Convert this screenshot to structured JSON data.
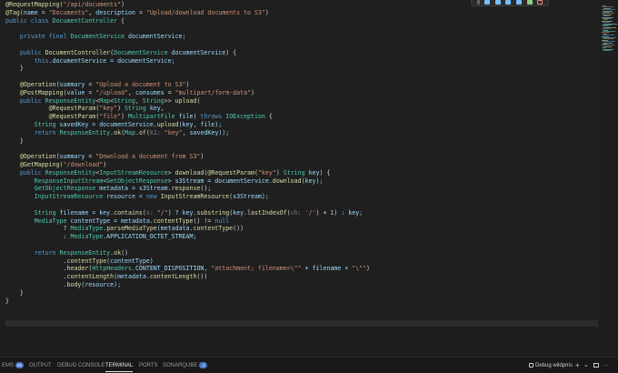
{
  "code_lines": [
    [
      [
        "@RequestMapping(",
        "ann"
      ],
      [
        "\"/api/documents\"",
        "str"
      ],
      [
        ")",
        "pl"
      ]
    ],
    [
      [
        "@Tag(",
        "ann"
      ],
      [
        "name",
        "var"
      ],
      [
        " = ",
        "pl"
      ],
      [
        "\"Documents\"",
        "str"
      ],
      [
        ", ",
        "pl"
      ],
      [
        "description",
        "var"
      ],
      [
        " = ",
        "pl"
      ],
      [
        "\"Upload/download documents to S3\"",
        "str"
      ],
      [
        ")",
        "pl"
      ]
    ],
    [
      [
        "public class ",
        "kw"
      ],
      [
        "DocumentController",
        "ty"
      ],
      [
        " {",
        "pl"
      ]
    ],
    [],
    [
      [
        "    private final ",
        "kw"
      ],
      [
        "DocumentService",
        "ty"
      ],
      [
        " documentService;",
        "var"
      ]
    ],
    [],
    [
      [
        "    public ",
        "kw"
      ],
      [
        "DocumentController",
        "fn"
      ],
      [
        "(",
        "pl"
      ],
      [
        "DocumentService",
        "ty"
      ],
      [
        " documentService",
        "var"
      ],
      [
        ") {",
        "pl"
      ]
    ],
    [
      [
        "        this",
        "kw"
      ],
      [
        ".documentService = documentService;",
        "var"
      ]
    ],
    [
      [
        "    }",
        "pl"
      ]
    ],
    [],
    [
      [
        "    @Operation(",
        "ann"
      ],
      [
        "summary",
        "var"
      ],
      [
        " = ",
        "pl"
      ],
      [
        "\"Upload a document to S3\"",
        "str"
      ],
      [
        ")",
        "pl"
      ]
    ],
    [
      [
        "    @PostMapping(",
        "ann"
      ],
      [
        "value",
        "var"
      ],
      [
        " = ",
        "pl"
      ],
      [
        "\"/upload\"",
        "str"
      ],
      [
        ", ",
        "pl"
      ],
      [
        "consumes",
        "var"
      ],
      [
        " = ",
        "pl"
      ],
      [
        "\"multipart/form-data\"",
        "str"
      ],
      [
        ")",
        "pl"
      ]
    ],
    [
      [
        "    public ",
        "kw"
      ],
      [
        "ResponseEntity",
        "ty"
      ],
      [
        "<",
        "pl"
      ],
      [
        "Map",
        "ty"
      ],
      [
        "<",
        "pl"
      ],
      [
        "String",
        "ty"
      ],
      [
        ", ",
        "pl"
      ],
      [
        "String",
        "ty"
      ],
      [
        ">> ",
        "pl"
      ],
      [
        "upload",
        "fn"
      ],
      [
        "(",
        "pl"
      ]
    ],
    [
      [
        "            @RequestParam(",
        "ann"
      ],
      [
        "\"key\"",
        "str"
      ],
      [
        ") ",
        "pl"
      ],
      [
        "String",
        "ty"
      ],
      [
        " key,",
        "var"
      ]
    ],
    [
      [
        "            @RequestParam(",
        "ann"
      ],
      [
        "\"file\"",
        "str"
      ],
      [
        ") ",
        "pl"
      ],
      [
        "MultipartFile",
        "ty"
      ],
      [
        " file",
        "var"
      ],
      [
        ") ",
        "pl"
      ],
      [
        "throws ",
        "kw"
      ],
      [
        "IOException",
        "ty"
      ],
      [
        " {",
        "pl"
      ]
    ],
    [
      [
        "        String",
        "ty"
      ],
      [
        " savedKey = documentService.",
        "var"
      ],
      [
        "upload",
        "fn"
      ],
      [
        "(key, file);",
        "var"
      ]
    ],
    [
      [
        "        return ",
        "kw"
      ],
      [
        "ResponseEntity",
        "ty"
      ],
      [
        ".",
        "pl"
      ],
      [
        "ok",
        "fn"
      ],
      [
        "(",
        "pl"
      ],
      [
        "Map",
        "ty"
      ],
      [
        ".",
        "pl"
      ],
      [
        "of",
        "fn"
      ],
      [
        "(",
        "pl"
      ],
      [
        "k1:",
        "hint"
      ],
      [
        " \"key\"",
        "str"
      ],
      [
        ", savedKey));",
        "var"
      ]
    ],
    [
      [
        "    }",
        "pl"
      ]
    ],
    [],
    [
      [
        "    @Operation(",
        "ann"
      ],
      [
        "summary",
        "var"
      ],
      [
        " = ",
        "pl"
      ],
      [
        "\"Download a document from S3\"",
        "str"
      ],
      [
        ")",
        "pl"
      ]
    ],
    [
      [
        "    @GetMapping(",
        "ann"
      ],
      [
        "\"/download\"",
        "str"
      ],
      [
        ")",
        "pl"
      ]
    ],
    [
      [
        "    public ",
        "kw"
      ],
      [
        "ResponseEntity",
        "ty"
      ],
      [
        "<",
        "pl"
      ],
      [
        "InputStreamResource",
        "ty"
      ],
      [
        "> ",
        "pl"
      ],
      [
        "download",
        "fn"
      ],
      [
        "(",
        "pl"
      ],
      [
        "@RequestParam(",
        "ann"
      ],
      [
        "\"key\"",
        "str"
      ],
      [
        ") ",
        "pl"
      ],
      [
        "String",
        "ty"
      ],
      [
        " key",
        "var"
      ],
      [
        ") {",
        "pl"
      ]
    ],
    [
      [
        "        ResponseInputStream",
        "ty"
      ],
      [
        "<",
        "pl"
      ],
      [
        "GetObjectResponse",
        "ty"
      ],
      [
        "> s3Stream = documentService.",
        "var"
      ],
      [
        "download",
        "fn"
      ],
      [
        "(key);",
        "var"
      ]
    ],
    [
      [
        "        GetObjectResponse",
        "ty"
      ],
      [
        " metadata = s3Stream.",
        "var"
      ],
      [
        "response",
        "fn"
      ],
      [
        "();",
        "pl"
      ]
    ],
    [
      [
        "        InputStreamResource",
        "ty"
      ],
      [
        " resource = ",
        "var"
      ],
      [
        "new ",
        "kw"
      ],
      [
        "InputStreamResource",
        "fn"
      ],
      [
        "(s3Stream);",
        "var"
      ]
    ],
    [],
    [
      [
        "        String",
        "ty"
      ],
      [
        " filename = key.",
        "var"
      ],
      [
        "contains",
        "fn"
      ],
      [
        "(",
        "pl"
      ],
      [
        "s:",
        "hint"
      ],
      [
        " \"/\"",
        "str"
      ],
      [
        ") ? key.",
        "var"
      ],
      [
        "substring",
        "fn"
      ],
      [
        "(key.",
        "var"
      ],
      [
        "lastIndexOf",
        "fn"
      ],
      [
        "(",
        "pl"
      ],
      [
        "ch:",
        "hint"
      ],
      [
        " '/'",
        "str"
      ],
      [
        ") + ",
        "pl"
      ],
      [
        "1",
        "num"
      ],
      [
        ") : key;",
        "var"
      ]
    ],
    [
      [
        "        MediaType",
        "ty"
      ],
      [
        " contentType = metadata.",
        "var"
      ],
      [
        "contentType",
        "fn"
      ],
      [
        "() != ",
        "pl"
      ],
      [
        "null",
        "kw"
      ]
    ],
    [
      [
        "                ? ",
        "pl"
      ],
      [
        "MediaType",
        "ty"
      ],
      [
        ".",
        "pl"
      ],
      [
        "parseMediaType",
        "fn"
      ],
      [
        "(metadata.",
        "var"
      ],
      [
        "contentType",
        "fn"
      ],
      [
        "())",
        "pl"
      ]
    ],
    [
      [
        "                : ",
        "pl"
      ],
      [
        "MediaType",
        "ty"
      ],
      [
        ".APPLICATION_OCTET_STREAM;",
        "var"
      ]
    ],
    [],
    [
      [
        "        return ",
        "kw"
      ],
      [
        "ResponseEntity",
        "ty"
      ],
      [
        ".",
        "pl"
      ],
      [
        "ok",
        "fn"
      ],
      [
        "()",
        "pl"
      ]
    ],
    [
      [
        "                .",
        "pl"
      ],
      [
        "contentType",
        "fn"
      ],
      [
        "(contentType)",
        "var"
      ]
    ],
    [
      [
        "                .",
        "pl"
      ],
      [
        "header",
        "fn"
      ],
      [
        "(",
        "pl"
      ],
      [
        "HttpHeaders",
        "ty"
      ],
      [
        ".CONTENT_DISPOSITION, ",
        "var"
      ],
      [
        "\"attachment; filename=\\\"\"",
        "str"
      ],
      [
        " + filename + ",
        "var"
      ],
      [
        "\"\\\"\"",
        "str"
      ],
      [
        ")",
        "pl"
      ]
    ],
    [
      [
        "                .",
        "pl"
      ],
      [
        "contentLength",
        "fn"
      ],
      [
        "(metadata.",
        "var"
      ],
      [
        "contentLength",
        "fn"
      ],
      [
        "())",
        "pl"
      ]
    ],
    [
      [
        "                .",
        "pl"
      ],
      [
        "body",
        "fn"
      ],
      [
        "(resource);",
        "var"
      ]
    ],
    [
      [
        "    }",
        "pl"
      ]
    ],
    [
      [
        "}",
        "pl"
      ]
    ]
  ],
  "colors": {
    "annotation": "#dcdcaa",
    "keyword": "#569cd6",
    "type": "#4ec9b0",
    "string": "#ce9178",
    "variable": "#9cdcfe",
    "hint": "#7f848e"
  },
  "panel": {
    "tabs": [
      {
        "label": "EMS",
        "badge": "65"
      },
      {
        "label": "OUTPUT"
      },
      {
        "label": "DEBUG CONSOLE"
      },
      {
        "label": "TERMINAL",
        "active": true
      },
      {
        "label": "PORTS"
      },
      {
        "label": "SONARQUBE",
        "badge": "4"
      }
    ],
    "debug_label": "Debug wildpms",
    "plus": "+",
    "chevron": "⌄",
    "more": "···"
  },
  "toolbar": {
    "icons": [
      "drag-grip-icon",
      "pause-icon",
      "step-over-icon",
      "step-into-icon",
      "step-out-icon",
      "restart-icon",
      "stop-icon"
    ]
  }
}
